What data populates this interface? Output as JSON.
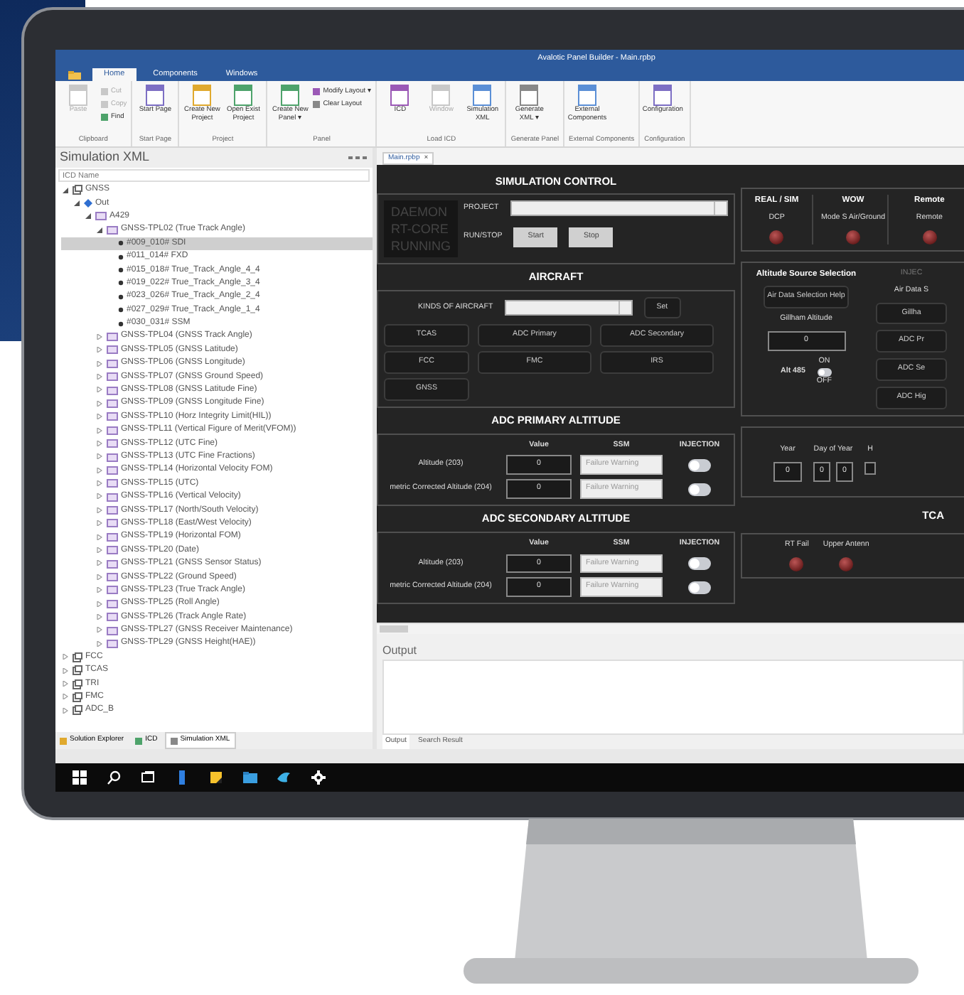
{
  "window": {
    "title": "Avalotic Panel Builder - Main.rpbp"
  },
  "ribbon": {
    "tabs": [
      {
        "label": "Home",
        "selected": true
      },
      {
        "label": "Components",
        "selected": false
      },
      {
        "label": "Windows",
        "selected": false
      }
    ],
    "groups": [
      {
        "label": "Clipboard",
        "items": [
          {
            "label": "Paste",
            "kind": "large",
            "disabled": true
          },
          {
            "label": "Cut",
            "kind": "small",
            "disabled": true
          },
          {
            "label": "Copy",
            "kind": "small",
            "disabled": true
          },
          {
            "label": "Find",
            "kind": "small",
            "disabled": false
          }
        ]
      },
      {
        "label": "Start Page",
        "items": [
          {
            "label": "Start Page",
            "kind": "large",
            "disabled": false
          }
        ]
      },
      {
        "label": "Project",
        "items": [
          {
            "label": "Create New Project",
            "kind": "large",
            "disabled": false
          },
          {
            "label": "Open Exist Project",
            "kind": "large",
            "disabled": false
          }
        ]
      },
      {
        "label": "Panel",
        "items": [
          {
            "label": "Create New Panel ▾",
            "kind": "large",
            "disabled": false
          },
          {
            "label": "Modify Layout ▾",
            "kind": "small",
            "disabled": false
          },
          {
            "label": "Clear Layout",
            "kind": "small",
            "disabled": false
          }
        ]
      },
      {
        "label": "Load ICD",
        "items": [
          {
            "label": "ICD",
            "kind": "large",
            "disabled": false
          },
          {
            "label": "Window",
            "kind": "large",
            "disabled": true
          },
          {
            "label": "Simulation XML",
            "kind": "large",
            "disabled": false
          }
        ]
      },
      {
        "label": "Generate Panel",
        "items": [
          {
            "label": "Generate XML ▾",
            "kind": "large",
            "disabled": false
          }
        ]
      },
      {
        "label": "External Components",
        "items": [
          {
            "label": "External Components",
            "kind": "large",
            "disabled": false
          }
        ]
      },
      {
        "label": "Configuration",
        "items": [
          {
            "label": "Configuration",
            "kind": "large",
            "disabled": false
          }
        ]
      }
    ]
  },
  "left_pane": {
    "title": "Simulation XML",
    "search": {
      "placeholder": "ICD Name"
    },
    "tree": [
      {
        "label": "GNSS",
        "kind": "device",
        "expanded": true,
        "selected": false,
        "children": [
          {
            "label": "Out",
            "kind": "port",
            "expanded": true,
            "selected": false,
            "children": [
              {
                "label": "A429",
                "kind": "bus",
                "expanded": true,
                "selected": false,
                "children": [
                  {
                    "label": "GNSS-TPL02 (True Track Angle)",
                    "kind": "label",
                    "expanded": true,
                    "selected": false,
                    "children": [
                      {
                        "label": "#009_010# SDI",
                        "kind": "field",
                        "selected": true
                      },
                      {
                        "label": "#011_014# FXD",
                        "kind": "field",
                        "selected": false
                      },
                      {
                        "label": "#015_018# True_Track_Angle_4_4",
                        "kind": "field",
                        "selected": false
                      },
                      {
                        "label": "#019_022# True_Track_Angle_3_4",
                        "kind": "field",
                        "selected": false
                      },
                      {
                        "label": "#023_026# True_Track_Angle_2_4",
                        "kind": "field",
                        "selected": false
                      },
                      {
                        "label": "#027_029# True_Track_Angle_1_4",
                        "kind": "field",
                        "selected": false
                      },
                      {
                        "label": "#030_031# SSM",
                        "kind": "field",
                        "selected": false
                      }
                    ]
                  },
                  {
                    "label": "GNSS-TPL04 (GNSS Track Angle)",
                    "kind": "label",
                    "expanded": false,
                    "selected": false
                  },
                  {
                    "label": "GNSS-TPL05 (GNSS Latitude)",
                    "kind": "label",
                    "expanded": false,
                    "selected": false
                  },
                  {
                    "label": "GNSS-TPL06 (GNSS Longitude)",
                    "kind": "label",
                    "expanded": false,
                    "selected": false
                  },
                  {
                    "label": "GNSS-TPL07 (GNSS Ground Speed)",
                    "kind": "label",
                    "expanded": false,
                    "selected": false
                  },
                  {
                    "label": "GNSS-TPL08 (GNSS Latitude Fine)",
                    "kind": "label",
                    "expanded": false,
                    "selected": false
                  },
                  {
                    "label": "GNSS-TPL09 (GNSS Longitude Fine)",
                    "kind": "label",
                    "expanded": false,
                    "selected": false
                  },
                  {
                    "label": "GNSS-TPL10 (Horz Integrity Limit(HIL))",
                    "kind": "label",
                    "expanded": false,
                    "selected": false
                  },
                  {
                    "label": "GNSS-TPL11 (Vertical Figure of Merit(VFOM))",
                    "kind": "label",
                    "expanded": false,
                    "selected": false
                  },
                  {
                    "label": "GNSS-TPL12 (UTC Fine)",
                    "kind": "label",
                    "expanded": false,
                    "selected": false
                  },
                  {
                    "label": "GNSS-TPL13 (UTC Fine Fractions)",
                    "kind": "label",
                    "expanded": false,
                    "selected": false
                  },
                  {
                    "label": "GNSS-TPL14 (Horizontal Velocity FOM)",
                    "kind": "label",
                    "expanded": false,
                    "selected": false
                  },
                  {
                    "label": "GNSS-TPL15 (UTC)",
                    "kind": "label",
                    "expanded": false,
                    "selected": false
                  },
                  {
                    "label": "GNSS-TPL16 (Vertical Velocity)",
                    "kind": "label",
                    "expanded": false,
                    "selected": false
                  },
                  {
                    "label": "GNSS-TPL17 (North/South Velocity)",
                    "kind": "label",
                    "expanded": false,
                    "selected": false
                  },
                  {
                    "label": "GNSS-TPL18 (East/West Velocity)",
                    "kind": "label",
                    "expanded": false,
                    "selected": false
                  },
                  {
                    "label": "GNSS-TPL19 (Horizontal FOM)",
                    "kind": "label",
                    "expanded": false,
                    "selected": false
                  },
                  {
                    "label": "GNSS-TPL20 (Date)",
                    "kind": "label",
                    "expanded": false,
                    "selected": false
                  },
                  {
                    "label": "GNSS-TPL21 (GNSS Sensor Status)",
                    "kind": "label",
                    "expanded": false,
                    "selected": false
                  },
                  {
                    "label": "GNSS-TPL22 (Ground Speed)",
                    "kind": "label",
                    "expanded": false,
                    "selected": false
                  },
                  {
                    "label": "GNSS-TPL23 (True Track Angle)",
                    "kind": "label",
                    "expanded": false,
                    "selected": false
                  },
                  {
                    "label": "GNSS-TPL25 (Roll Angle)",
                    "kind": "label",
                    "expanded": false,
                    "selected": false
                  },
                  {
                    "label": "GNSS-TPL26 (Track Angle Rate)",
                    "kind": "label",
                    "expanded": false,
                    "selected": false
                  },
                  {
                    "label": "GNSS-TPL27 (GNSS Receiver Maintenance)",
                    "kind": "label",
                    "expanded": false,
                    "selected": false
                  },
                  {
                    "label": "GNSS-TPL29 (GNSS Height(HAE))",
                    "kind": "label",
                    "expanded": false,
                    "selected": false
                  }
                ]
              }
            ]
          }
        ]
      },
      {
        "label": "FCC",
        "kind": "device",
        "expanded": false,
        "selected": false
      },
      {
        "label": "TCAS",
        "kind": "device",
        "expanded": false,
        "selected": false
      },
      {
        "label": "TRI",
        "kind": "device",
        "expanded": false,
        "selected": false
      },
      {
        "label": "FMC",
        "kind": "device",
        "expanded": false,
        "selected": false
      },
      {
        "label": "ADC_B",
        "kind": "device",
        "expanded": false,
        "selected": false
      }
    ],
    "tabs": [
      {
        "label": "Solution Explorer",
        "selected": false
      },
      {
        "label": "ICD",
        "selected": false
      },
      {
        "label": "Simulation XML",
        "selected": true
      }
    ]
  },
  "document_tab": {
    "label": "Main.rpbp",
    "close": "×"
  },
  "panel": {
    "simulation_control": {
      "title": "SIMULATION CONTROL",
      "status": [
        "DAEMON",
        "RT-CORE",
        "RUNNING"
      ],
      "project_label": "PROJECT",
      "run_label": "RUN/STOP",
      "buttons": [
        "Start",
        "Stop"
      ]
    },
    "aircraft": {
      "title": "AIRCRAFT",
      "kinds_label": "KINDS OF AIRCRAFT",
      "set_button": "Set",
      "systems": [
        "TCAS",
        "ADC Primary",
        "ADC Secondary",
        "FCC",
        "FMC",
        "IRS",
        "GNSS"
      ]
    },
    "altitude_sections": [
      {
        "title": "ADC PRIMARY ALTITUDE",
        "columns": [
          "Value",
          "SSM",
          "INJECTION"
        ],
        "rows": [
          {
            "label": "Altitude (203)",
            "value": "0",
            "ssm": "Failure Warning",
            "injection": false
          },
          {
            "label": "metric Corrected Altitude (204)",
            "value": "0",
            "ssm": "Failure Warning",
            "injection": false
          }
        ]
      },
      {
        "title": "ADC SECONDARY ALTITUDE",
        "columns": [
          "Value",
          "SSM",
          "INJECTION"
        ],
        "rows": [
          {
            "label": "Altitude (203)",
            "value": "0",
            "ssm": "Failure Warning",
            "injection": false
          },
          {
            "label": "metric Corrected Altitude (204)",
            "value": "0",
            "ssm": "Failure Warning",
            "injection": false
          }
        ]
      }
    ],
    "discretes": [
      {
        "title": "REAL / SIM",
        "label": "DCP",
        "lit": false
      },
      {
        "title": "WOW",
        "label": "Mode S Air/Ground",
        "lit": false
      },
      {
        "title": "Remote",
        "label": "Remote",
        "lit": false
      }
    ],
    "altitude_source": {
      "title": "Altitude Source Selection",
      "inject_label": "INJEC",
      "help_button": "Air Data Selection Help",
      "gillham_label": "Gillham Altitude",
      "gillham_value": "0",
      "on_label": "ON",
      "alt_label": "Alt 485",
      "alt_on": false,
      "off_label": "OFF",
      "air_data_title": "Air Data S",
      "air_data_buttons": [
        "Gillha",
        "ADC Pr",
        "ADC Se",
        "ADC Hig"
      ]
    },
    "date": [
      {
        "label": "Year",
        "values": [
          "0"
        ]
      },
      {
        "label": "Day of Year",
        "values": [
          "0",
          "0"
        ]
      },
      {
        "label": "H"
      }
    ],
    "tcas": {
      "title": "TCA",
      "lamps": [
        {
          "label": "RT Fail",
          "lit": false
        },
        {
          "label": "Upper Antenn",
          "lit": false
        }
      ]
    }
  },
  "output": {
    "title": "Output",
    "tabs": [
      {
        "label": "Output",
        "selected": true
      },
      {
        "label": "Search Result",
        "selected": false
      }
    ]
  }
}
